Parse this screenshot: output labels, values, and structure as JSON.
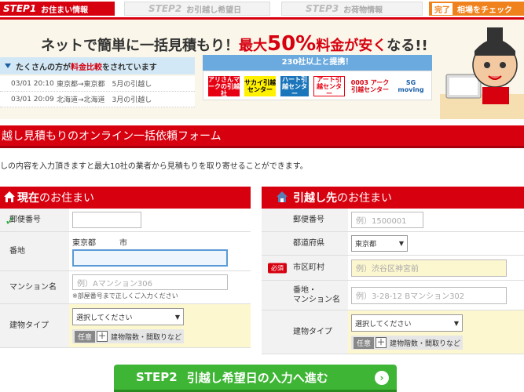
{
  "steps": {
    "step1_num": "STEP1",
    "step1_label": "お住まい情報",
    "step2_num": "STEP2",
    "step2_label": "お引越し希望日",
    "step3_num": "STEP3",
    "step3_label": "お荷物情報",
    "done_num": "完了",
    "done_label": "相場をチェック"
  },
  "banner": {
    "headline_prefix": "ネットで簡単に一括見積もり！",
    "headline_highlight_a": "最大",
    "headline_highlight_b": "50%",
    "headline_highlight_c": "料金が安く",
    "headline_suffix": "なる!!",
    "compare_prefix": "たくさんの方が",
    "compare_highlight": "料金比較",
    "compare_suffix": "をされています",
    "feed": [
      {
        "time": "03/01 20:10",
        "text": "東京都→東京都　5月の引越し"
      },
      {
        "time": "03/01 20:09",
        "text": "北海道→北海道　3月の引越し"
      }
    ],
    "partners_title": "230社以上と提携！",
    "partner_logos": [
      "アリさんマークの引越社",
      "サカイ引越センター",
      "ハート引越センター",
      "アート引越センター",
      "0003 アーク引越センター",
      "SG moving"
    ]
  },
  "form": {
    "title": "越し見積もりのオンライン一括依頼フォーム",
    "description": "しの内容を入力頂きますと最大10社の業者から見積もりを取り寄せることができます。"
  },
  "current": {
    "heading_a": "現在",
    "heading_b": "のお住まい",
    "postal_label": "郵便番号",
    "postal_value": "",
    "address_label": "番地",
    "address_prefill": "東京都　　　市",
    "address_value": "",
    "mansion_label": "マンション名",
    "mansion_placeholder": "例）Aマンション306",
    "mansion_note": "※部屋番号まで正しくご入力ください",
    "building_label": "建物タイプ",
    "building_select": "選択してください",
    "optional_badge": "任意",
    "optional_plus": "＋",
    "optional_text": "建物階数・間取りなど"
  },
  "destination": {
    "heading_a": "引越し先",
    "heading_b": "のお住まい",
    "postal_label": "郵便番号",
    "postal_placeholder": "例）1500001",
    "pref_label": "都道府県",
    "pref_value": "東京都",
    "city_badge": "必須",
    "city_label": "市区町村",
    "city_placeholder": "例）渋谷区神宮前",
    "address_label": "番地・\nマンション名",
    "address_placeholder": "例）3-28-12 Bマンション302",
    "building_label": "建物タイプ",
    "building_select": "選択してください",
    "optional_badge": "任意",
    "optional_plus": "＋",
    "optional_text": "建物階数・間取りなど"
  },
  "next_button": {
    "step": "STEP2",
    "label": "引越し希望日の入力へ進む",
    "arrow": "›"
  },
  "colors": {
    "brand_red": "#d7000f",
    "accent_orange": "#f0821e",
    "cta_green": "#3fb535",
    "info_blue": "#6aaadf"
  }
}
